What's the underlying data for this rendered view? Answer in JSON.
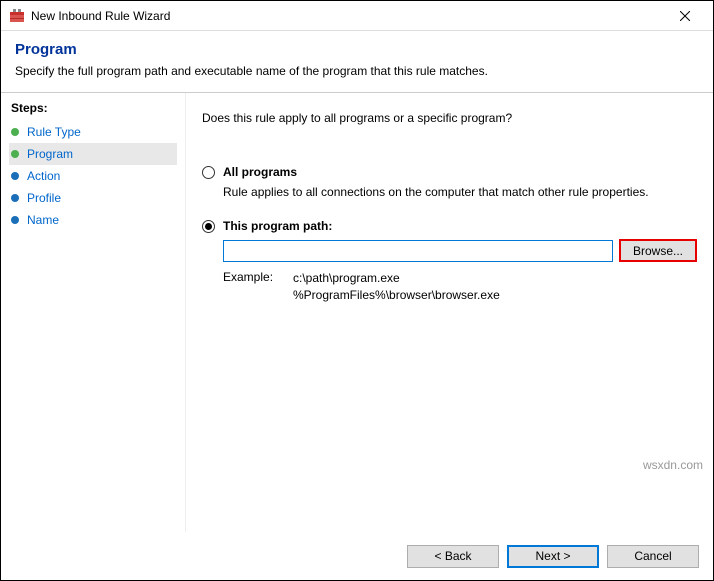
{
  "window": {
    "title": "New Inbound Rule Wizard"
  },
  "header": {
    "title": "Program",
    "description": "Specify the full program path and executable name of the program that this rule matches."
  },
  "sidebar": {
    "title": "Steps:",
    "items": [
      {
        "label": "Rule Type"
      },
      {
        "label": "Program"
      },
      {
        "label": "Action"
      },
      {
        "label": "Profile"
      },
      {
        "label": "Name"
      }
    ]
  },
  "main": {
    "question": "Does this rule apply to all programs or a specific program?",
    "allPrograms": {
      "label": "All programs",
      "desc": "Rule applies to all connections on the computer that match other rule properties."
    },
    "thisPath": {
      "label": "This program path:",
      "value": "",
      "browse": "Browse...",
      "exampleLabel": "Example:",
      "example1": "c:\\path\\program.exe",
      "example2": "%ProgramFiles%\\browser\\browser.exe"
    }
  },
  "footer": {
    "back": "< Back",
    "next": "Next >",
    "cancel": "Cancel"
  },
  "watermark": "wsxdn.com"
}
